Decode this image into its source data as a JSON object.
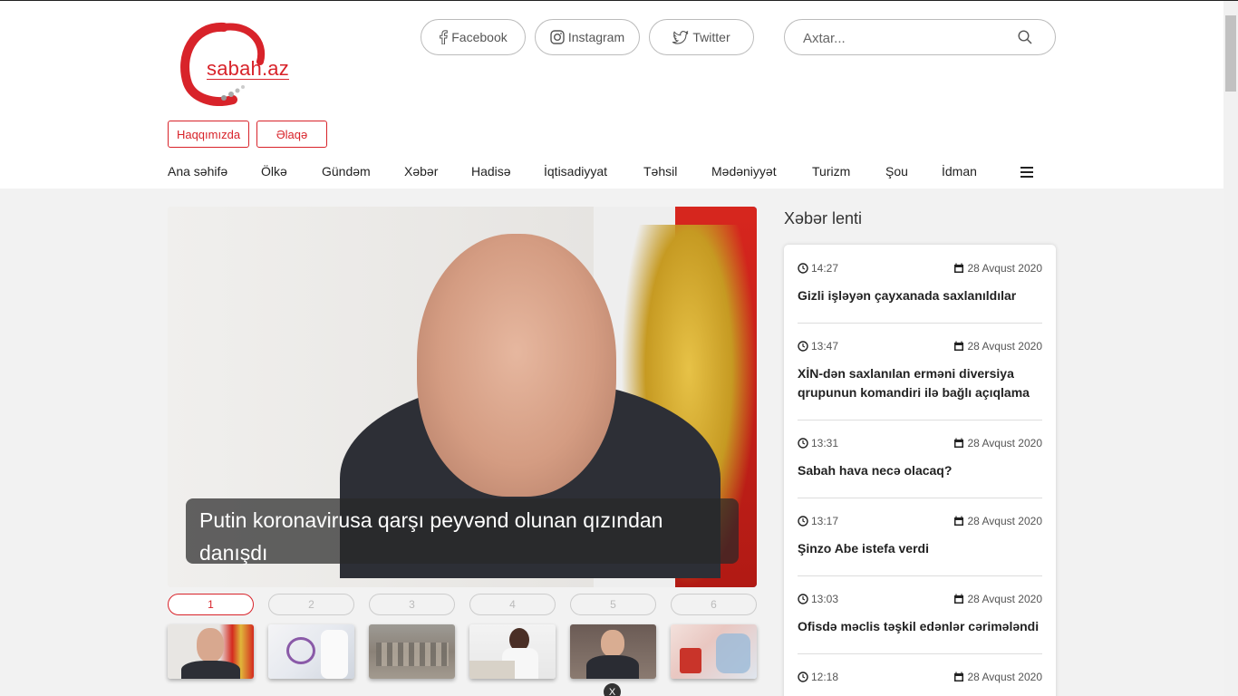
{
  "brand": {
    "logo_text": "sabah.az"
  },
  "social": [
    {
      "label": "Facebook"
    },
    {
      "label": "Instagram"
    },
    {
      "label": "Twitter"
    }
  ],
  "search": {
    "placeholder": "Axtar..."
  },
  "top_links": {
    "about": "Haqqımızda",
    "contact": "Əlaqə"
  },
  "nav": [
    "Ana səhifə",
    "Ölkə",
    "Gündəm",
    "Xəbər",
    "Hadisə",
    "İqtisadiyyat",
    "Təhsil",
    "Mədəniyyət",
    "Turizm",
    "Şou",
    "İdman"
  ],
  "hero": {
    "headline": "Putin koronavirusa qarşı peyvənd olunan qızından danışdı"
  },
  "pager": [
    "1",
    "2",
    "3",
    "4",
    "5",
    "6"
  ],
  "active_page": 1,
  "close_label": "X",
  "feed": {
    "title": "Xəbər lenti",
    "items": [
      {
        "time": "14:27",
        "date": "28 Avqust 2020",
        "headline": "Gizli işləyən çayxanada saxlanıldılar"
      },
      {
        "time": "13:47",
        "date": "28 Avqust 2020",
        "headline": "XİN-dən saxlanılan erməni diversiya qrupunun komandiri ilə bağlı açıqlama"
      },
      {
        "time": "13:31",
        "date": "28 Avqust 2020",
        "headline": "Sabah hava necə olacaq?"
      },
      {
        "time": "13:17",
        "date": "28 Avqust 2020",
        "headline": "Şinzo Abe istefa verdi"
      },
      {
        "time": "13:03",
        "date": "28 Avqust 2020",
        "headline": "Ofisdə məclis təşkil edənlər cərimələndi"
      },
      {
        "time": "12:18",
        "date": "28 Avqust 2020",
        "headline": ""
      }
    ]
  },
  "colors": {
    "brand_red": "#d8232a"
  }
}
